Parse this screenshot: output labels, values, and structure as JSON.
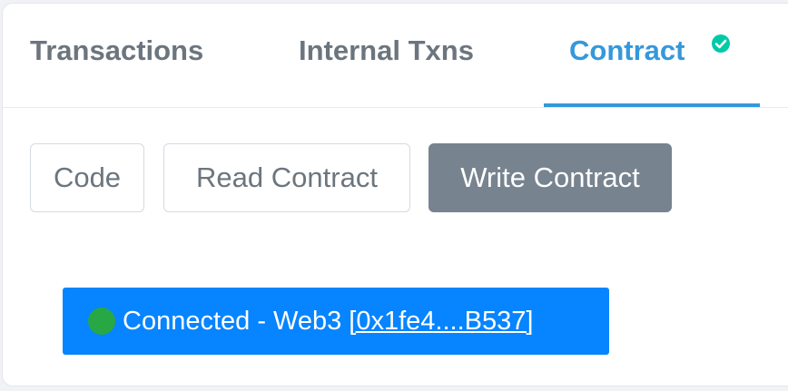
{
  "tabs": {
    "transactions": "Transactions",
    "internal_txns": "Internal Txns",
    "contract": "Contract",
    "active": "Contract"
  },
  "contract_icon": "verified-check-icon",
  "subtabs": {
    "code": "Code",
    "read": "Read Contract",
    "write": "Write Contract",
    "active": "Write Contract"
  },
  "connection": {
    "status_icon": "status-dot-icon",
    "label": "Connected - Web3",
    "address": "[0x1fe4....B537]"
  },
  "colors": {
    "accent": "#3498db",
    "active_subtab": "#77838f",
    "connect_button": "#0784ff",
    "status_dot": "#28a745",
    "verified_check": "#00c9a7"
  }
}
